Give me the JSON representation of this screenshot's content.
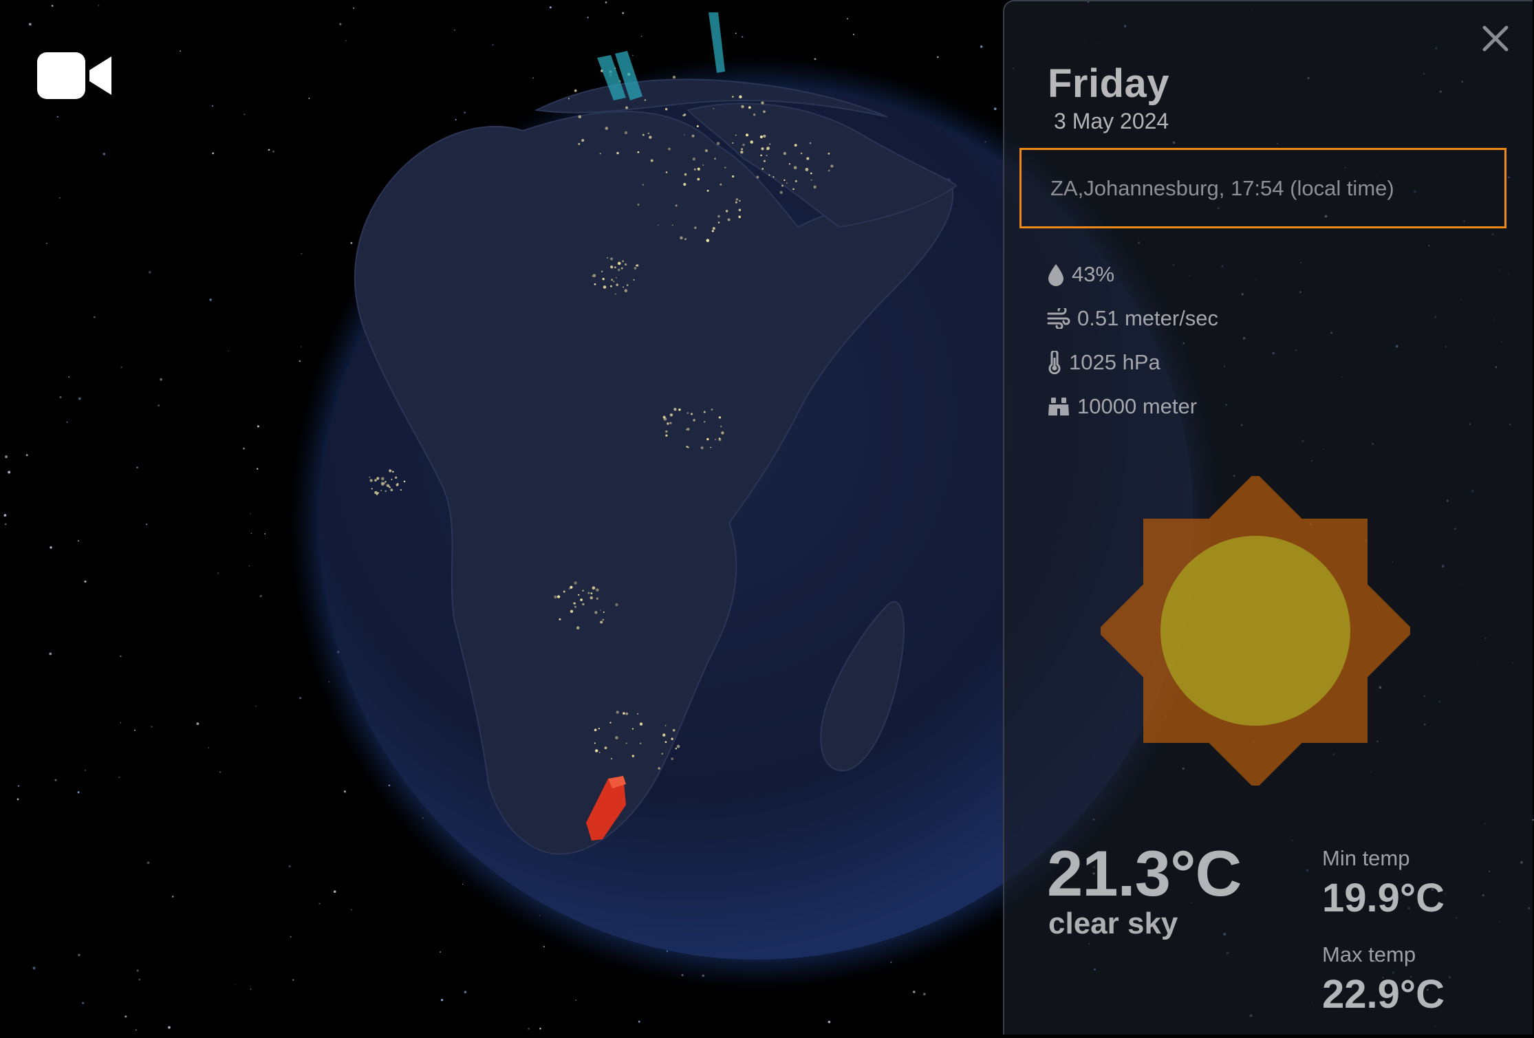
{
  "app": {
    "video_icon": "video-camera-icon",
    "close_icon": "close-icon"
  },
  "colors": {
    "background": "#000000",
    "globe_ocean": "#121a33",
    "marker_selected": "#d8321f",
    "marker_other": "#2aa6b8",
    "highlight_border": "#ef8a18",
    "sun_rays": "#b35a0c",
    "sun_core": "#a8a020"
  },
  "weather": {
    "day": "Friday",
    "date": "3 May 2024",
    "location": "ZA,Johannesburg, 17:54 (local time)",
    "humidity": "43%",
    "wind": "0.51 meter/sec",
    "pressure": "1025 hPa",
    "visibility": "10000 meter",
    "icon": "clear-sky-sun-icon",
    "temperature": "21.3°C",
    "description": "clear sky",
    "min_label": "Min temp",
    "min_value": "19.9°C",
    "max_label": "Max temp",
    "max_value": "22.9°C"
  }
}
